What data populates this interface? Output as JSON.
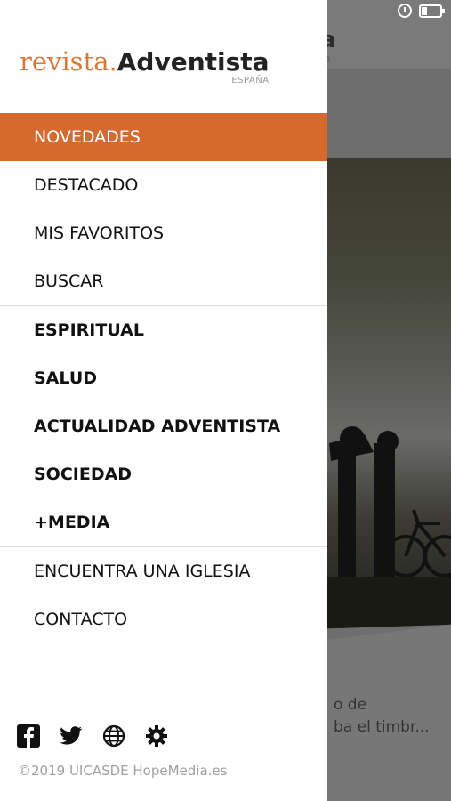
{
  "background": {
    "title_fragment": "a",
    "subtitle_fragment": "A",
    "excerpt_lines": [
      "o de",
      "ba el timbr..."
    ]
  },
  "drawer": {
    "logo": {
      "light": "revista",
      "dot": ".",
      "bold": "Adventista",
      "country": "ESPAÑA"
    },
    "menu_group_1": [
      {
        "label": "NOVEDADES",
        "active": true
      },
      {
        "label": "DESTACADO"
      },
      {
        "label": "MIS FAVORITOS"
      },
      {
        "label": "BUSCAR"
      }
    ],
    "menu_group_2": [
      {
        "label": "ESPIRITUAL"
      },
      {
        "label": "SALUD"
      },
      {
        "label": "ACTUALIDAD ADVENTISTA"
      },
      {
        "label": "SOCIEDAD"
      },
      {
        "label": "+MEDIA"
      }
    ],
    "menu_group_3": [
      {
        "label": "ENCUENTRA UNA IGLESIA"
      },
      {
        "label": "CONTACTO"
      }
    ],
    "social_icons": [
      "facebook-icon",
      "twitter-icon",
      "globe-icon",
      "gear-icon"
    ],
    "copyright": "©2019 UICASDE HopeMedia.es"
  },
  "colors": {
    "accent": "#d46a2e",
    "logo_orange": "#d7793c"
  }
}
